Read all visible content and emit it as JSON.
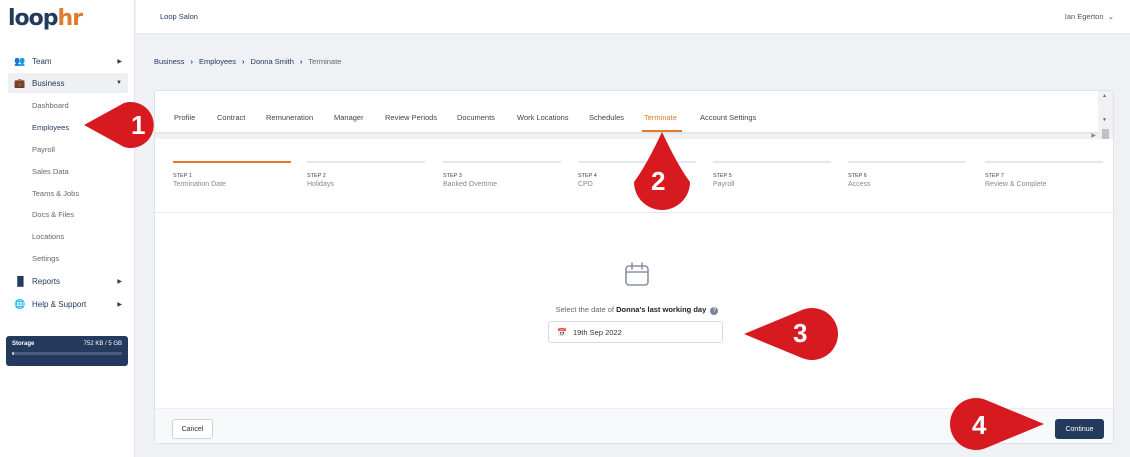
{
  "logo": {
    "part1": "loop",
    "part2": "hr"
  },
  "sidebar": {
    "main_items": [
      {
        "label": "Team",
        "icon": "team-icon"
      },
      {
        "label": "Business",
        "icon": "briefcase-icon"
      },
      {
        "label": "Reports",
        "icon": "bar-chart-icon"
      },
      {
        "label": "Help & Support",
        "icon": "globe-icon"
      }
    ],
    "sub_items": [
      "Dashboard",
      "Employees",
      "Payroll",
      "Sales Data",
      "Teams & Jobs",
      "Docs & Files",
      "Locations",
      "Settings"
    ],
    "selected_sub": "Employees"
  },
  "storage": {
    "label": "Storage",
    "usage": "752 KB / 5 GB",
    "fill_fraction": 0.02
  },
  "topbar": {
    "company": "Loop Salon",
    "user": "Ian Egerton"
  },
  "breadcrumb": [
    "Business",
    "Employees",
    "Donna Smith",
    "Terminate"
  ],
  "tabs": [
    {
      "label": "Profile"
    },
    {
      "label": "Contract"
    },
    {
      "label": "Remuneration"
    },
    {
      "label": "Manager"
    },
    {
      "label": "Review Periods"
    },
    {
      "label": "Documents"
    },
    {
      "label": "Work Locations"
    },
    {
      "label": "Schedules"
    },
    {
      "label": "Terminate",
      "selected": true
    },
    {
      "label": "Account Settings"
    }
  ],
  "steps": [
    {
      "num": "STEP 1",
      "name": "Termination Date",
      "active": true
    },
    {
      "num": "STEP 2",
      "name": "Holidays"
    },
    {
      "num": "STEP 3",
      "name": "Banked Overtime"
    },
    {
      "num": "STEP 4",
      "name": "CPD"
    },
    {
      "num": "STEP 5",
      "name": "Payroll"
    },
    {
      "num": "STEP 6",
      "name": "Access"
    },
    {
      "num": "STEP 7",
      "name": "Review & Complete"
    }
  ],
  "prompt": {
    "pre": "Select the date of ",
    "bold": "Donna's last working day"
  },
  "date_input": {
    "value": "19th Sep 2022"
  },
  "buttons": {
    "cancel": "Cancel",
    "continue": "Continue"
  },
  "markers": [
    "1",
    "2",
    "3",
    "4"
  ],
  "colors": {
    "brand_navy": "#233a5c",
    "accent_orange": "#e07b2a",
    "marker_red": "#d71920"
  }
}
